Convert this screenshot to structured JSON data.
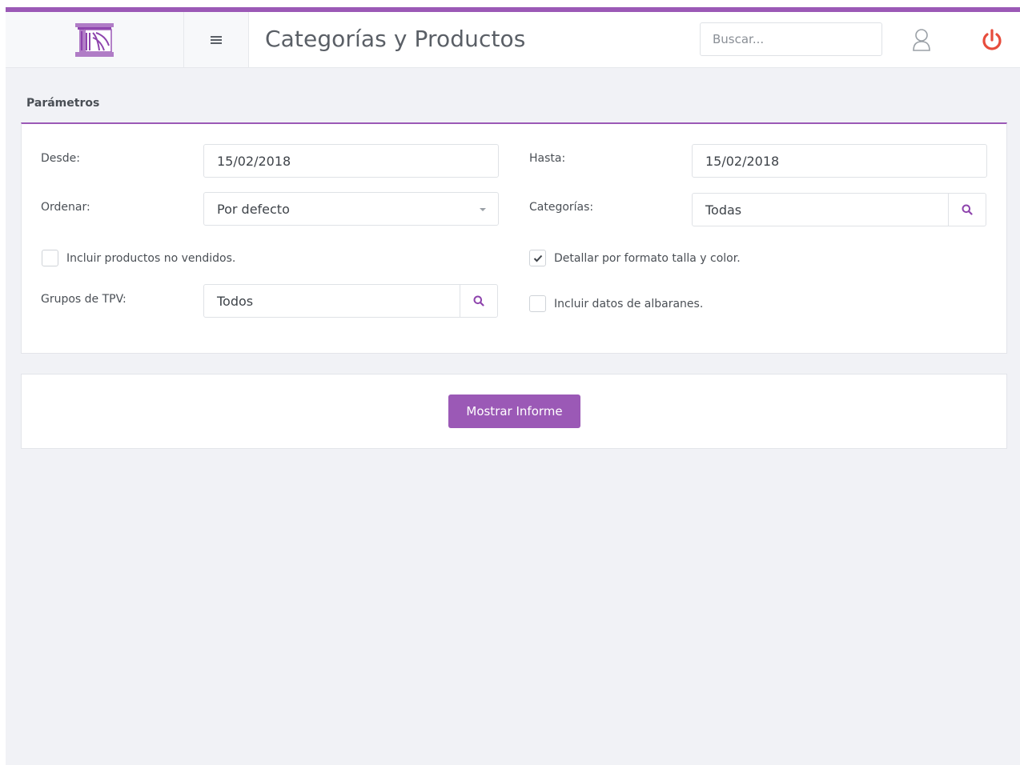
{
  "app": {
    "title": "Categorías y Productos",
    "accent_color": "#9b59b6",
    "logo_icon": "column-building-logo",
    "menu_icon": "hamburger-icon",
    "user_icon": "user-icon",
    "power_icon": "power-icon",
    "power_color": "#e74c3c"
  },
  "search": {
    "placeholder": "Buscar..."
  },
  "params": {
    "section_title": "Parámetros",
    "desde": {
      "label": "Desde:",
      "value": "15/02/2018"
    },
    "hasta": {
      "label": "Hasta:",
      "value": "15/02/2018"
    },
    "ordenar": {
      "label": "Ordenar:",
      "value": "Por defecto"
    },
    "categorias": {
      "label": "Categorías:",
      "value": "Todas"
    },
    "incluir_no_vendidos": {
      "label": "Incluir productos no vendidos.",
      "checked": false
    },
    "detallar_formato": {
      "label": "Detallar por formato talla y color.",
      "checked": true
    },
    "grupos_tpv": {
      "label": "Grupos de TPV:",
      "value": "Todos"
    },
    "incluir_albaranes": {
      "label": "Incluir datos de albaranes.",
      "checked": false
    }
  },
  "actions": {
    "show_report": "Mostrar Informe"
  }
}
